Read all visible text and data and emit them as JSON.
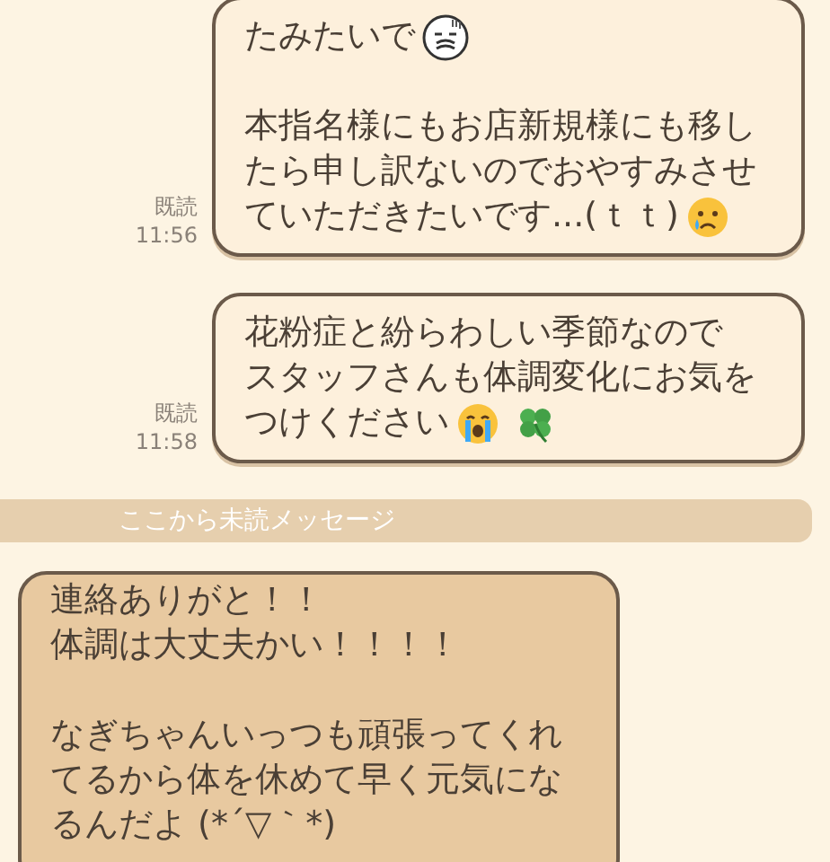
{
  "messages": [
    {
      "kind": "outgoing",
      "read": "既読",
      "time": "11:56",
      "paragraphs": [
        {
          "lines": [
            {
              "text": "たみたいで",
              "emoji": [
                {
                  "kind": "grimace"
                }
              ]
            }
          ]
        },
        {
          "lines": [
            {
              "text": "本指名様にもお店新規様にも移し"
            },
            {
              "text": "たら申し訳ないのでおやすみさせ"
            },
            {
              "text": "ていただきたいです...(ｔｔ)",
              "emoji": [
                {
                  "kind": "tear"
                }
              ]
            }
          ]
        }
      ]
    },
    {
      "kind": "outgoing",
      "read": "既読",
      "time": "11:58",
      "paragraphs": [
        {
          "lines": [
            {
              "text": "花粉症と紛らわしい季節なので"
            },
            {
              "text": "スタッフさんも体調変化にお気を"
            },
            {
              "text": "つけください",
              "emoji": [
                {
                  "kind": "sob"
                },
                {
                  "kind": "clover"
                }
              ]
            }
          ]
        }
      ]
    },
    {
      "kind": "divider",
      "text": "ここから未読メッセージ"
    },
    {
      "kind": "incoming",
      "paragraphs": [
        {
          "lines": [
            {
              "text": "連絡ありがと！！"
            },
            {
              "text": "体調は大丈夫かい！！！！"
            }
          ]
        },
        {
          "lines": [
            {
              "text": "なぎちゃんいっつも頑張ってくれ"
            },
            {
              "text": "てるから体を休めて早く元気にな"
            },
            {
              "text": "るんだよ (*´▽｀*)"
            }
          ]
        }
      ]
    }
  ]
}
